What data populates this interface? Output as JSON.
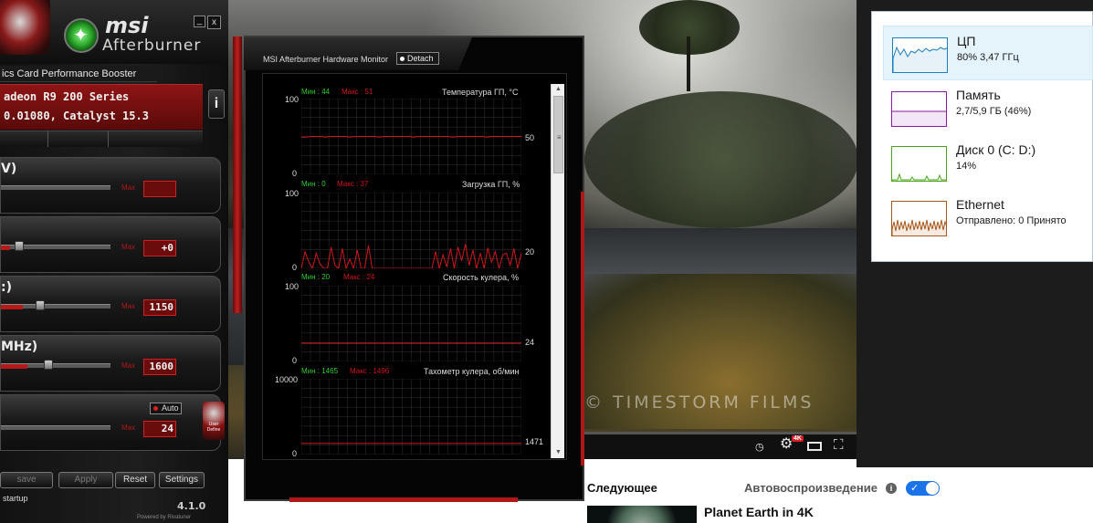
{
  "afterburner": {
    "brand": "msi",
    "product": "Afterburner",
    "tagline": "ics Card Performance Booster",
    "card_line1": "adeon R9 200 Series",
    "card_line2": "0.01080, Catalyst 15.3",
    "info_button": "i",
    "minimize_label": "_",
    "close_label": "x",
    "sliders": [
      {
        "label": "V)",
        "max_label": "Max",
        "value": "",
        "level": 0.0
      },
      {
        "label": "",
        "max_label": "Max",
        "value": "+0",
        "level": 0.08
      },
      {
        "label": ":)",
        "max_label": "Max",
        "value": "1150",
        "level": 0.2
      },
      {
        "label": "MHz)",
        "max_label": "Max",
        "value": "1600",
        "level": 0.24
      },
      {
        "label": "",
        "max_label": "Max",
        "value": "24",
        "level": 0.0
      }
    ],
    "auto_label": "Auto",
    "user_define_label": "User Define",
    "buttons": {
      "save": "save",
      "apply": "Apply",
      "reset": "Reset",
      "settings": "Settings"
    },
    "startup_label": "startup",
    "version": "4.1.0",
    "powered_by": "Powered by Rivatuner"
  },
  "hardware_monitor": {
    "title": "MSI Afterburner Hardware Monitor",
    "detach_label": "Detach",
    "graphs": [
      {
        "title": "Температура ГП, °C",
        "min_label": "Мин : 44",
        "max_label": "Макс : 51",
        "y_max": "100",
        "y_min": "0",
        "current": "50",
        "values": [
          49,
          49,
          50,
          50,
          50,
          49,
          50,
          50,
          50,
          50,
          49,
          50,
          50,
          50,
          50,
          50,
          49,
          50,
          50,
          50,
          50,
          50,
          50,
          49,
          50,
          50,
          50,
          50,
          50,
          50,
          50,
          49,
          50,
          50,
          50,
          50,
          50,
          50,
          49,
          50,
          50,
          50,
          50,
          50,
          50,
          50
        ]
      },
      {
        "title": "Загрузка ГП, %",
        "min_label": "Мин : 0",
        "max_label": "Макс : 37",
        "y_max": "100",
        "y_min": "0",
        "current": "20",
        "values": [
          0,
          22,
          8,
          0,
          20,
          6,
          0,
          0,
          28,
          4,
          0,
          26,
          0,
          12,
          0,
          24,
          0,
          0,
          30,
          0,
          0,
          0,
          0,
          0,
          0,
          0,
          0,
          0,
          0,
          0,
          0,
          0,
          0,
          0,
          0,
          0,
          22,
          0,
          18,
          2,
          26,
          0,
          28,
          10,
          32,
          4,
          24,
          0,
          20,
          0,
          27,
          8,
          22,
          0,
          18,
          20,
          4,
          26,
          0,
          20
        ]
      },
      {
        "title": "Скорость кулера, %",
        "min_label": "Мин : 20",
        "max_label": "Макс : 24",
        "y_max": "100",
        "y_min": "0",
        "current": "24",
        "values": [
          24,
          24,
          24,
          24,
          24,
          24,
          24,
          24,
          24,
          24,
          24,
          24
        ]
      },
      {
        "title": "Тахометр кулера, об/мин",
        "min_label": "Мин : 1465",
        "max_label": "Макс : 1496",
        "y_max": "10000",
        "y_min": "0",
        "current": "1471",
        "values": [
          1471,
          1471,
          1471,
          1471,
          1471,
          1471,
          1471,
          1471,
          1471,
          1471,
          1471,
          1471
        ]
      }
    ]
  },
  "video": {
    "watermark": "© TIMESTORM FILMS",
    "quality_badge": "4K",
    "up_next_title": "Следующее",
    "autoplay_label": "Автовоспроизведение",
    "next_video_title": "Planet Earth in 4K"
  },
  "task_manager": {
    "items": [
      {
        "name": "ЦП",
        "detail": "80% 3,47 ГГц",
        "color": "#1a7ec0"
      },
      {
        "name": "Память",
        "detail": "2,7/5,9 ГБ (46%)",
        "color": "#8b1aa3"
      },
      {
        "name": "Диск 0 (C: D:)",
        "detail": "14%",
        "color": "#4ca31a"
      },
      {
        "name": "Ethernet",
        "detail": "Отправлено: 0 Принято",
        "color": "#a7561a"
      }
    ]
  },
  "colors": {
    "afterburner_red": "#b51a1a",
    "monitor_line": "#d01818",
    "min_green": "#2ecc2e"
  }
}
